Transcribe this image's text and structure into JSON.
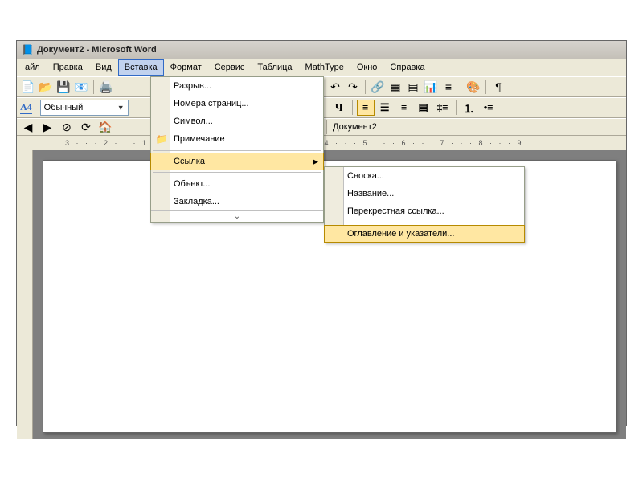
{
  "titlebar": {
    "title": "Документ2 - Microsoft Word"
  },
  "menubar": {
    "file": "айл",
    "edit": "Правка",
    "view": "Вид",
    "insert": "Вставка",
    "format": "Формат",
    "service": "Сервис",
    "table": "Таблица",
    "mathtype": "MathType",
    "window": "Окно",
    "help": "Справка"
  },
  "style_selector": "Обычный",
  "doc_indicator": "Документ2",
  "dropdown_insert": {
    "break": "Разрыв...",
    "page_numbers": "Номера страниц...",
    "symbol": "Символ...",
    "note": "Примечание",
    "link": "Ссылка",
    "object": "Объект...",
    "bookmark": "Закладка..."
  },
  "submenu_link": {
    "footnote": "Сноска...",
    "caption": "Название...",
    "crossref": "Перекрестная ссылка...",
    "toc": "Оглавление и указатели..."
  },
  "ruler_top": "3 · · · 2 · · · 1 · · · · · · 1 · · · 2 · · · 3 · · · 4 · · · 5 · · · 6 · · · 7 · · · 8 · · · 9",
  "paragraph_mark": "¶"
}
